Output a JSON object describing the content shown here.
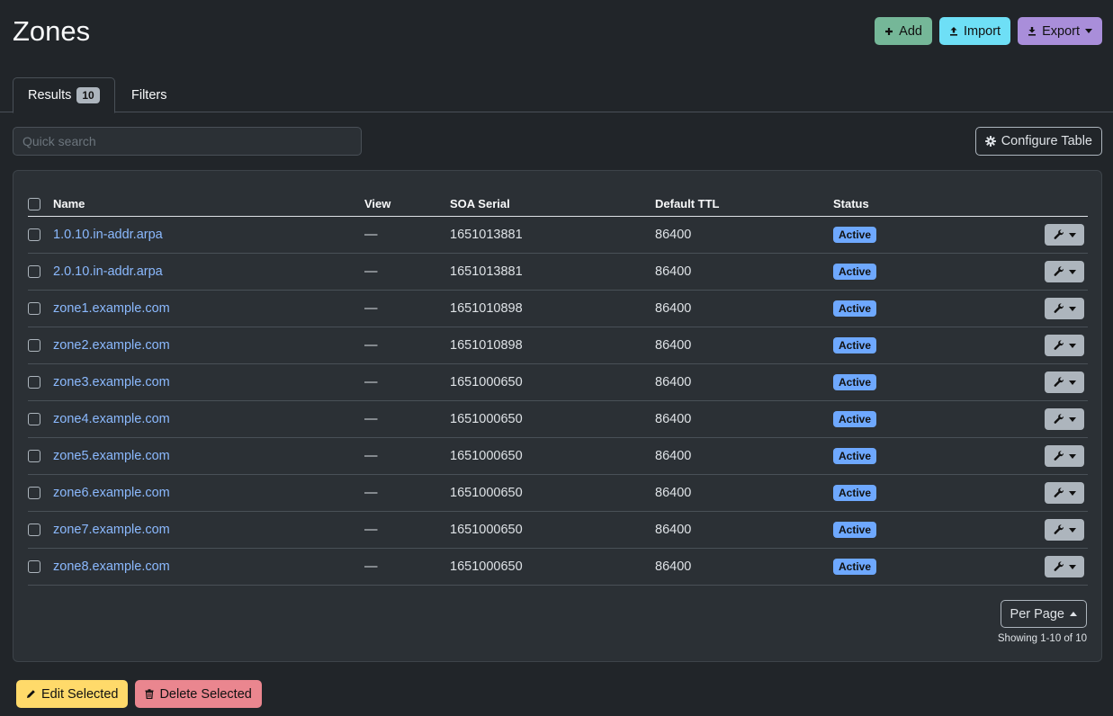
{
  "page": {
    "title": "Zones"
  },
  "actions": {
    "add": "Add",
    "import": "Import",
    "export": "Export"
  },
  "tabs": {
    "results": "Results",
    "results_count": "10",
    "filters": "Filters"
  },
  "search": {
    "placeholder": "Quick search"
  },
  "configure_table": "Configure Table",
  "table": {
    "columns": [
      "Name",
      "View",
      "SOA Serial",
      "Default TTL",
      "Status"
    ],
    "rows": [
      {
        "name": "1.0.10.in-addr.arpa",
        "view": "—",
        "soa_serial": "1651013881",
        "ttl": "86400",
        "status": "Active"
      },
      {
        "name": "2.0.10.in-addr.arpa",
        "view": "—",
        "soa_serial": "1651013881",
        "ttl": "86400",
        "status": "Active"
      },
      {
        "name": "zone1.example.com",
        "view": "—",
        "soa_serial": "1651010898",
        "ttl": "86400",
        "status": "Active"
      },
      {
        "name": "zone2.example.com",
        "view": "—",
        "soa_serial": "1651010898",
        "ttl": "86400",
        "status": "Active"
      },
      {
        "name": "zone3.example.com",
        "view": "—",
        "soa_serial": "1651000650",
        "ttl": "86400",
        "status": "Active"
      },
      {
        "name": "zone4.example.com",
        "view": "—",
        "soa_serial": "1651000650",
        "ttl": "86400",
        "status": "Active"
      },
      {
        "name": "zone5.example.com",
        "view": "—",
        "soa_serial": "1651000650",
        "ttl": "86400",
        "status": "Active"
      },
      {
        "name": "zone6.example.com",
        "view": "—",
        "soa_serial": "1651000650",
        "ttl": "86400",
        "status": "Active"
      },
      {
        "name": "zone7.example.com",
        "view": "—",
        "soa_serial": "1651000650",
        "ttl": "86400",
        "status": "Active"
      },
      {
        "name": "zone8.example.com",
        "view": "—",
        "soa_serial": "1651000650",
        "ttl": "86400",
        "status": "Active"
      }
    ]
  },
  "pagination": {
    "per_page": "Per Page",
    "showing": "Showing 1-10 of 10"
  },
  "bulk": {
    "edit": "Edit Selected",
    "delete": "Delete Selected"
  },
  "colors": {
    "bg": "#212529",
    "add": "#75b798",
    "import": "#6edff6",
    "export": "#a98eda",
    "link": "#8bb9fe",
    "status_active": "#6ea8fe",
    "edit": "#ffda6a",
    "delete": "#ea868f"
  },
  "icons": {
    "add": "plus-icon",
    "import": "upload-icon",
    "export": "download-icon",
    "configure": "gear-icon",
    "row_tools": "wrench-icon",
    "edit": "pencil-icon",
    "delete": "trash-icon"
  }
}
